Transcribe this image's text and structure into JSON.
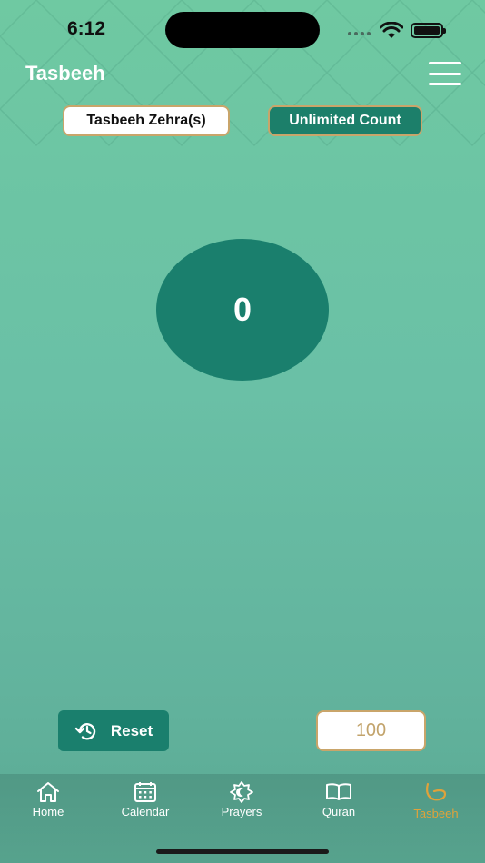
{
  "status_bar": {
    "time": "6:12"
  },
  "header": {
    "title": "Tasbeeh"
  },
  "modes": {
    "zehra_label": "Tasbeeh Zehra(s)",
    "unlimited_label": "Unlimited Count"
  },
  "counter": {
    "value": "0"
  },
  "controls": {
    "reset_label": "Reset",
    "target_value": "100"
  },
  "tabs": [
    {
      "label": "Home",
      "icon": "home-icon"
    },
    {
      "label": "Calendar",
      "icon": "calendar-icon"
    },
    {
      "label": "Prayers",
      "icon": "mosque-crescent-icon"
    },
    {
      "label": "Quran",
      "icon": "open-book-icon"
    },
    {
      "label": "Tasbeeh",
      "icon": "tasbeeh-beads-icon"
    }
  ],
  "colors": {
    "accent": "#1a7f6d",
    "border_gold": "#c9a56a",
    "active_tab": "#e0a23a",
    "background_top": "#6fc9a2",
    "background_bottom": "#5aa993"
  }
}
